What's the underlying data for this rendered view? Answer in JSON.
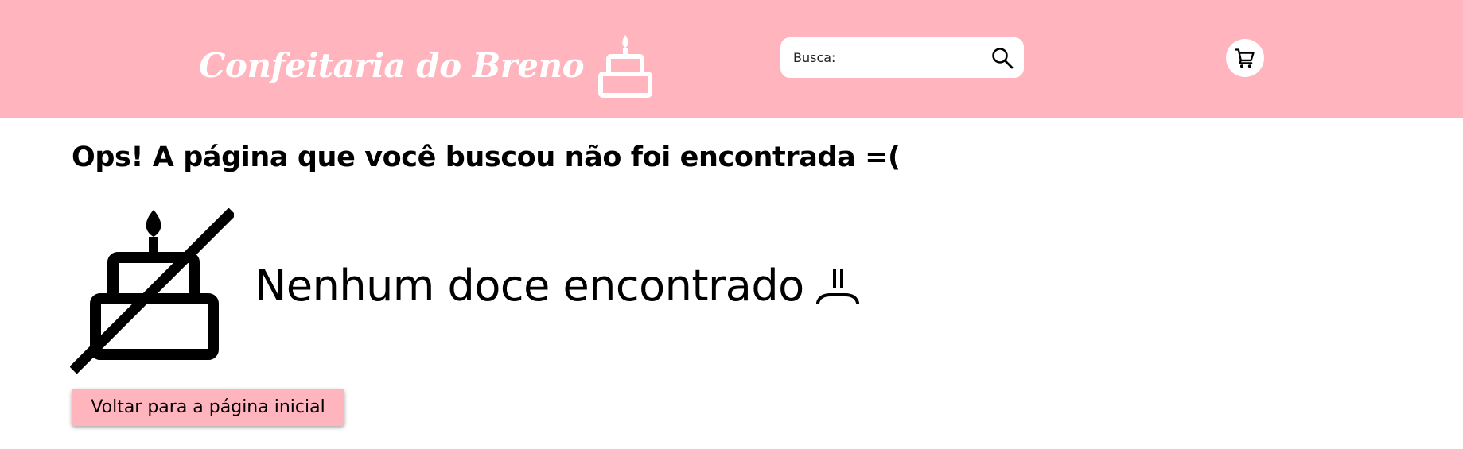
{
  "header": {
    "brand_name": "Confeitaria do Breno",
    "brand_icon": "cake-icon",
    "search": {
      "placeholder": "Busca:",
      "value": "",
      "icon": "search-icon"
    },
    "cart_icon": "cart-icon"
  },
  "main": {
    "title": "Ops! A página que você buscou não foi encontrada =(",
    "empty_icon": "no-cake-icon",
    "empty_message": "Nenhum doce encontrado",
    "sad_icon": "sad-face-icon",
    "back_button_label": "Voltar para a página inicial"
  },
  "colors": {
    "header_background": "#ffb4be",
    "button_background": "#ffb4be",
    "text": "#000000",
    "brand_text": "#ffffff"
  }
}
